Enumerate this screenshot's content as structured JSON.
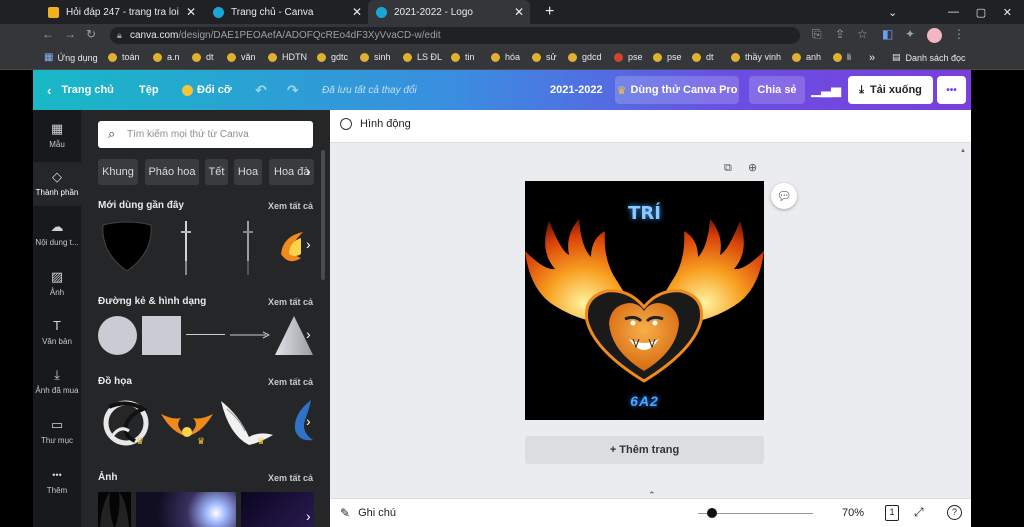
{
  "browser": {
    "tabs": [
      {
        "title": "Hỏi đáp 247 - trang tra loi",
        "favicon_color": "#f2b01e"
      },
      {
        "title": "Trang chủ - Canva",
        "favicon_color": "#1aa7d8"
      },
      {
        "title": "2021-2022 - Logo",
        "favicon_color": "#1aa7d8"
      }
    ],
    "new_tab_symbol": "+",
    "url_host": "canva.com",
    "url_path": "/design/DAE1PEOAefA/ADOFQcREo4dF3XyVvaCD-w/edit",
    "bookmarks": [
      "Ứng dụng",
      "toán",
      "a.n",
      "dt",
      "văn",
      "HDTN",
      "gdtc",
      "sinh",
      "LS ĐL",
      "tin",
      "hóa",
      "sử",
      "gdcd",
      "pse",
      "pse",
      "dt",
      "thầy vinh",
      "anh",
      "li"
    ],
    "bookmarks_more": "»",
    "reading_list": "Danh sách đọc"
  },
  "canva": {
    "home": "Trang chủ",
    "file": "Tệp",
    "resize": "Đổi cỡ",
    "saved_status": "Đã lưu tất cả thay đổi",
    "design_title": "2021-2022",
    "try_pro": "Dùng thử Canva Pro",
    "share": "Chia sẻ",
    "download": "Tải xuống",
    "more": "•••",
    "accent_gradient": [
      "#18b8c6",
      "#7a3fdc"
    ]
  },
  "rail": [
    {
      "label": "Mẫu",
      "icon": "template-icon",
      "glyph": "▦"
    },
    {
      "label": "Thành phần",
      "icon": "elements-icon",
      "glyph": "◇"
    },
    {
      "label": "Nội dung t...",
      "icon": "upload-icon",
      "glyph": "☁"
    },
    {
      "label": "Ảnh",
      "icon": "photo-icon",
      "glyph": "▨"
    },
    {
      "label": "Văn bản",
      "icon": "text-icon",
      "glyph": "T"
    },
    {
      "label": "Ảnh đã mua",
      "icon": "download-icon",
      "glyph": "⤓"
    },
    {
      "label": "Thư mục",
      "icon": "folder-icon",
      "glyph": "▭"
    },
    {
      "label": "Thêm",
      "icon": "more-icon",
      "glyph": "•••"
    }
  ],
  "panel": {
    "search_placeholder": "Tìm kiếm mọi thứ từ Canva",
    "chips": [
      "Khung",
      "Pháo hoa",
      "Tết",
      "Hoa",
      "Hoa đà"
    ],
    "sections": [
      {
        "title": "Mới dùng gần đây",
        "see_all": "Xem tất cả"
      },
      {
        "title": "Đường kẻ & hình dạng",
        "see_all": "Xem tất cả"
      },
      {
        "title": "Đồ họa",
        "see_all": "Xem tất cả"
      },
      {
        "title": "Ảnh",
        "see_all": "Xem tất cả"
      }
    ]
  },
  "editor": {
    "animate": "Hình động",
    "design_text_top": "TRÍ",
    "design_text_bottom": "6A2",
    "add_page": "+ Thêm trang",
    "notes": "Ghi chú",
    "zoom": "70%",
    "page_count": "1",
    "help": "?"
  }
}
